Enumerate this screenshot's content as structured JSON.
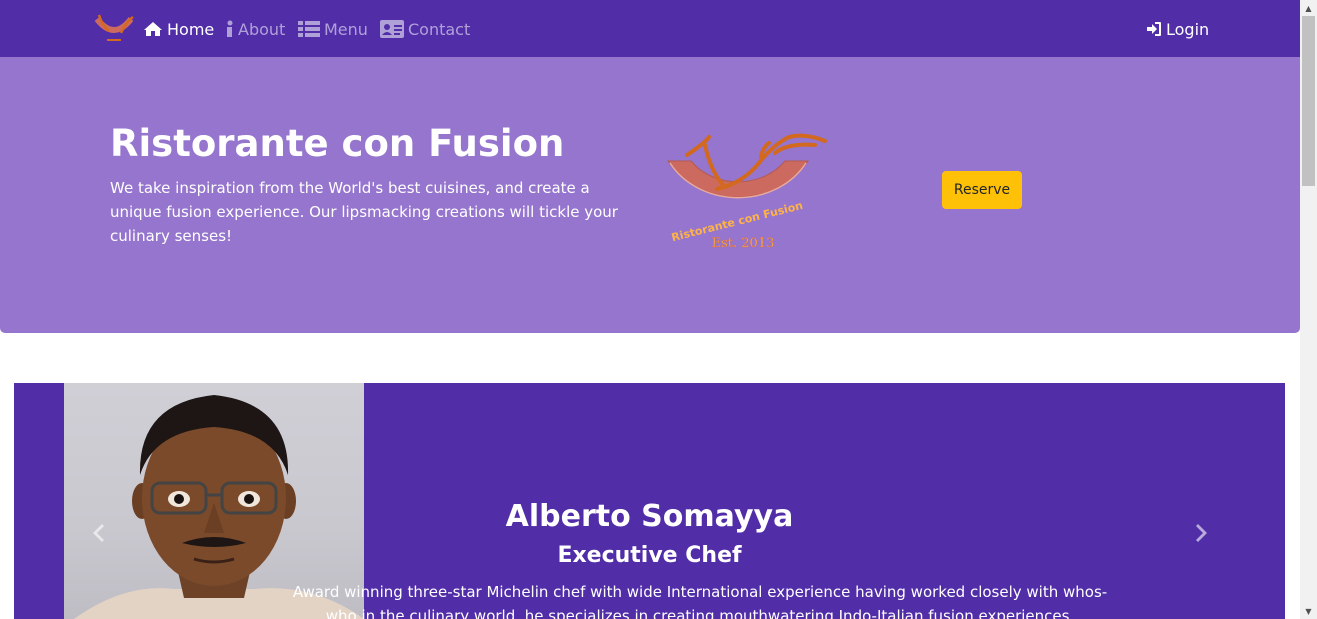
{
  "navbar": {
    "items": [
      {
        "label": "Home",
        "icon": "home-icon",
        "active": true
      },
      {
        "label": "About",
        "icon": "info-icon",
        "active": false
      },
      {
        "label": "Menu",
        "icon": "list-icon",
        "active": false
      },
      {
        "label": "Contact",
        "icon": "address-card-icon",
        "active": false
      }
    ],
    "login_label": "Login",
    "logo_icon": "restaurant-logo"
  },
  "hero": {
    "title": "Ristorante con Fusion",
    "text": "We take inspiration from the World's best cuisines, and create a unique fusion experience. Our lipsmacking creations will tickle your culinary senses!",
    "logo_text": "Ristorante con Fusion",
    "logo_est": "Est. 2013",
    "reserve_label": "Reserve"
  },
  "carousel": {
    "name": "Alberto Somayya",
    "role": "Executive Chef",
    "description": "Award winning three-star Michelin chef with wide International experience having worked closely with whos-who in the culinary world, he specializes in creating mouthwatering Indo-Italian fusion experiences."
  },
  "colors": {
    "primary": "#512da8",
    "light_primary": "#9575cd",
    "warning": "#ffc107",
    "logo_orange": "#d2691e",
    "logo_red": "#cd6a5f"
  }
}
